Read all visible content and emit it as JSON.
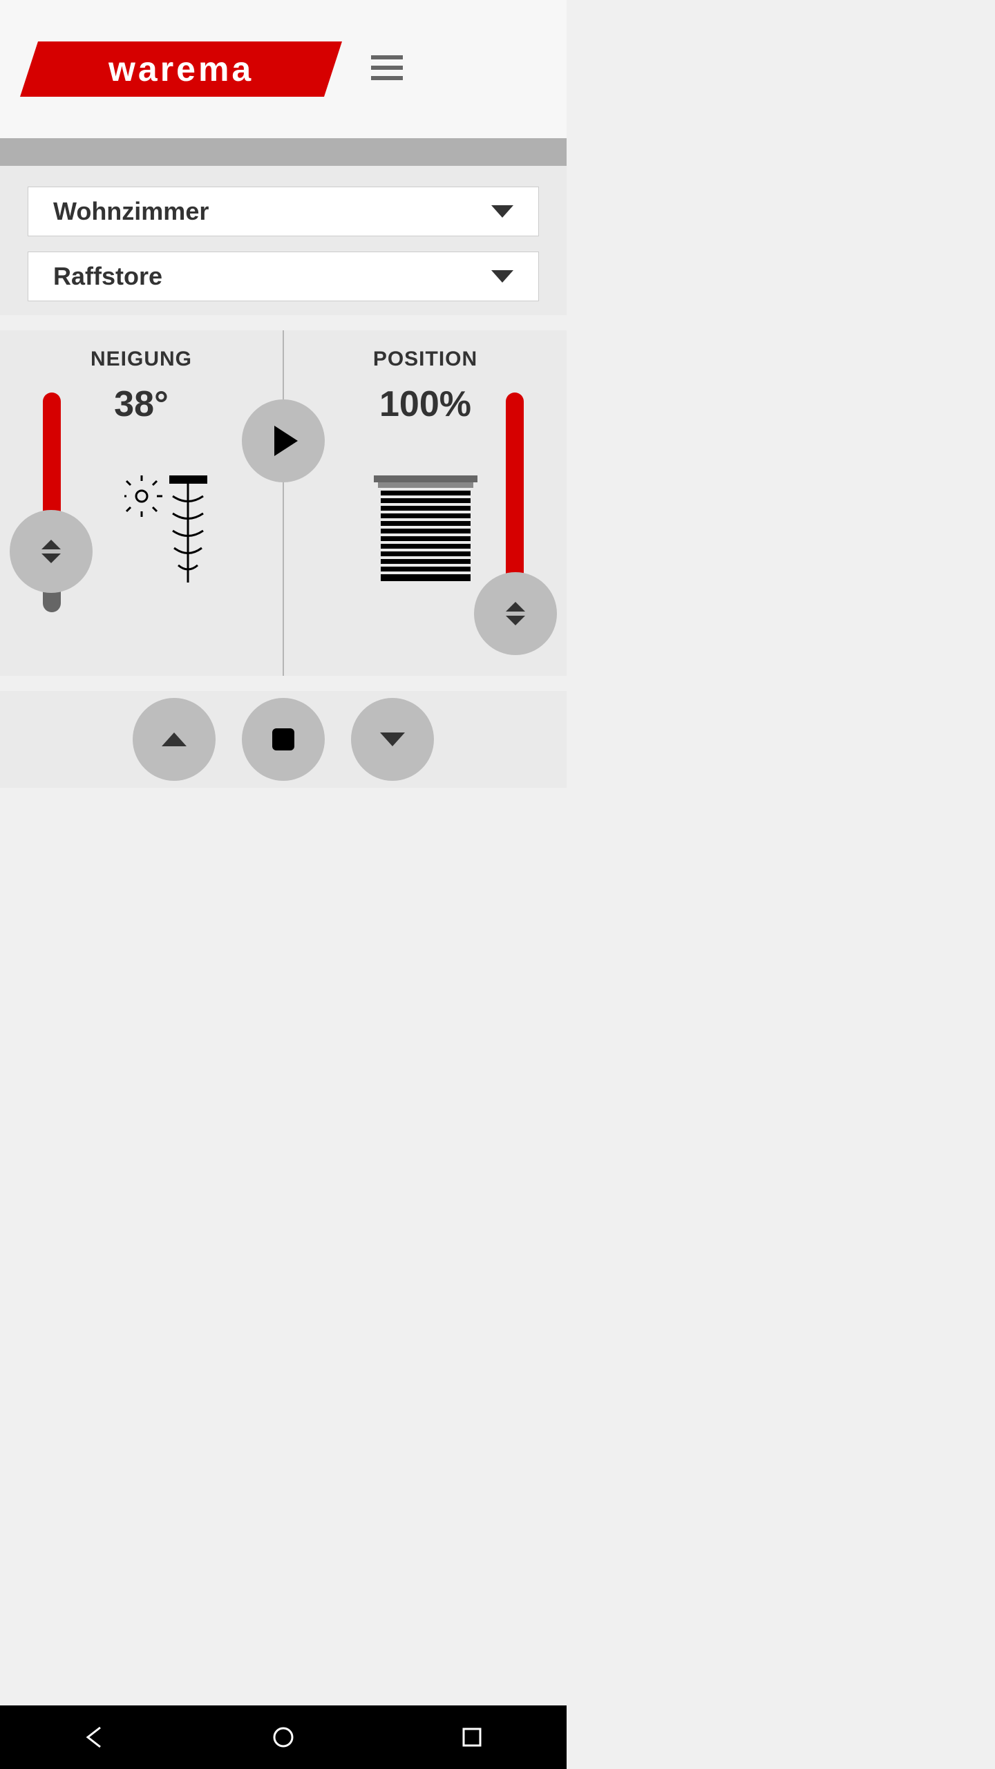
{
  "brand": {
    "name": "warema"
  },
  "selectors": {
    "room": "Wohnzimmer",
    "product": "Raffstore"
  },
  "tilt": {
    "label": "NEIGUNG",
    "value": "38°"
  },
  "position": {
    "label": "POSITION",
    "value": "100%"
  },
  "colors": {
    "accent": "#d60000",
    "thumb": "#bdbdbd"
  }
}
